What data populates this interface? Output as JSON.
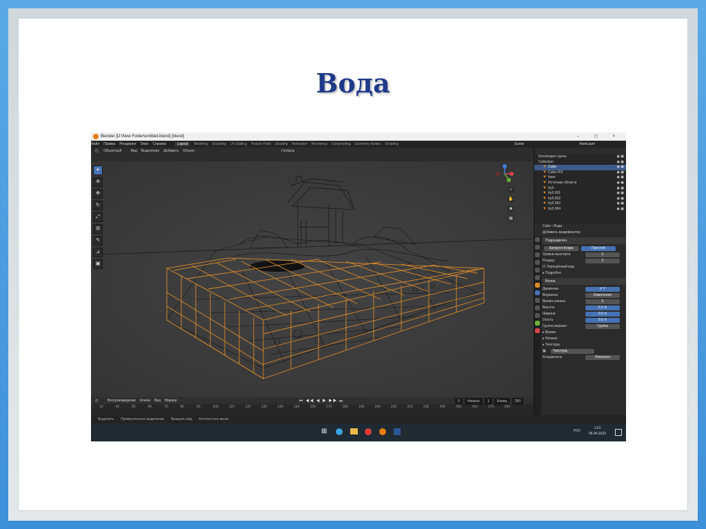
{
  "slide": {
    "title": "Вода"
  },
  "window": {
    "title": "Blender [D:\\New Folder\\untitled.blend] [blend]",
    "controls": "– ◻ ×"
  },
  "menu": {
    "items": [
      "Файл",
      "Правка",
      "Рендеринг",
      "Окно",
      "Справка"
    ],
    "workspaces": [
      "Layout",
      "Modeling",
      "Sculpting",
      "UV Editing",
      "Texture Paint",
      "Shading",
      "Animation",
      "Rendering",
      "Compositing",
      "Geometry Nodes",
      "Scripting"
    ],
    "active_workspace": "Layout",
    "scene": "Scene",
    "view_layer": "ViewLayer"
  },
  "viewport": {
    "mode": "Объектный",
    "menus": [
      "Вид",
      "Выделение",
      "Добавить",
      "Объект"
    ],
    "transform": "Глобаль"
  },
  "timeline": {
    "menus": [
      "Воспроизведение",
      "Ключи",
      "Вид",
      "Маркер"
    ],
    "current_frame": "0",
    "start_label": "Начало",
    "start": "1",
    "end_label": "Конец",
    "end": "250",
    "ruler": [
      "10",
      "40",
      "50",
      "60",
      "70",
      "80",
      "90",
      "100",
      "110",
      "120",
      "130",
      "140",
      "150",
      "160",
      "170",
      "180",
      "190",
      "200",
      "210",
      "220",
      "230",
      "240",
      "250",
      "260",
      "270",
      "280"
    ]
  },
  "status": [
    "Выделить",
    "Прямоугольное выделение",
    "Вращать вид",
    "Контекстное меню"
  ],
  "outliner": {
    "search_placeholder": "",
    "rows": [
      {
        "label": "Коллекция сцены",
        "sel": false,
        "coll": true
      },
      {
        "label": "Collection",
        "sel": false,
        "coll": true
      },
      {
        "label": "Cube",
        "sel": true,
        "coll": false
      },
      {
        "label": "Cube.001",
        "sel": false,
        "coll": false
      },
      {
        "label": "base",
        "sel": false,
        "coll": false
      },
      {
        "label": "Источник области",
        "sel": false,
        "coll": false
      },
      {
        "label": "Куб",
        "sel": false,
        "coll": false
      },
      {
        "label": "Куб.001",
        "sel": false,
        "coll": false
      },
      {
        "label": "Куб.002",
        "sel": false,
        "coll": false
      },
      {
        "label": "Куб.003",
        "sel": false,
        "coll": false
      },
      {
        "label": "Куб.004",
        "sel": false,
        "coll": false
      }
    ]
  },
  "properties": {
    "breadcrumb": "Cube › Вода",
    "add_modifier": "Добавить модификатор",
    "mod1_name": "Подразделен.",
    "mod1_tabs": [
      "Катмулл-Кларк",
      "Простой"
    ],
    "mod1_rows": [
      {
        "label": "Уровни вьюпорта",
        "value": "2"
      },
      {
        "label": "Рендер",
        "value": "2"
      }
    ],
    "mod1_check": "Упрощённый вид",
    "mod1_sub": "Подробно",
    "mod2_name": "Волна",
    "mod2_rows": [
      {
        "label": "Движение",
        "value": "X   Y",
        "blue": true
      },
      {
        "label": "Вершины",
        "value": "Изменения",
        "blue": false
      },
      {
        "label": "Время начала",
        "value": "0",
        "blue": false
      },
      {
        "label": "Высота",
        "value": "0.1 m",
        "blue": true
      },
      {
        "label": "Ширина",
        "value": "0.5 m",
        "blue": true
      },
      {
        "label": "Узость",
        "value": "0.5 m",
        "blue": true
      },
      {
        "label": "Группа вершин",
        "value": "Группа",
        "blue": false
      }
    ],
    "mod2_subs": [
      "Время",
      "Начало",
      "Текстура"
    ],
    "texture_label": "Текстура",
    "coords_label": "Координаты",
    "coords_value": "Локально"
  },
  "taskbar": {
    "time": "1:51",
    "date": "06.04.2022",
    "lang": "РУС"
  }
}
